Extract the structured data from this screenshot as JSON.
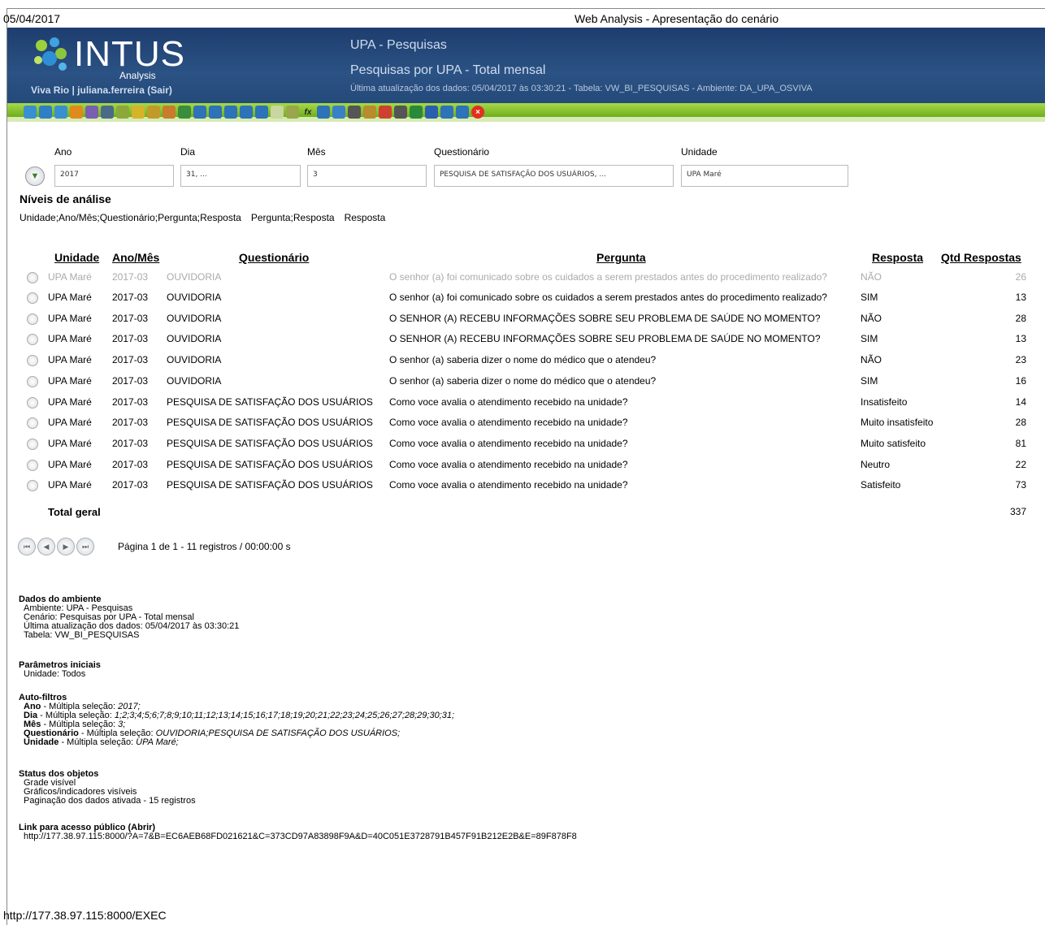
{
  "print_header": {
    "date": "05/04/2017",
    "title": "Web Analysis - Apresentação do cenário"
  },
  "print_footer": {
    "url": "http://177.38.97.115:8000/EXEC"
  },
  "banner": {
    "logo_word": "INTUS",
    "logo_sub": "Analysis",
    "user_text": "Viva Rio | juliana.ferreira (Sair)",
    "environment": "UPA - Pesquisas",
    "scenario": "Pesquisas por UPA - Total mensal",
    "update_line": "Última atualização dos dados: 05/04/2017 às 03:30:21 - Tabela: VW_BI_PESQUISAS - Ambiente: DA_UPA_OSVIVA"
  },
  "toolbar": {
    "icons": [
      "home-icon",
      "back-icon",
      "refresh-icon",
      "pin-icon",
      "presentation-icon",
      "screen-icon",
      "flask-icon",
      "filter-icon",
      "filter2-icon",
      "hierarchy-icon",
      "spellcheck-icon",
      "columns-icon",
      "grid-icon",
      "rows-icon",
      "sum-icon",
      "copy-icon",
      "table-icon",
      "bars-icon",
      "fx-icon",
      "chart-icon",
      "line-chart-icon",
      "pie-icon",
      "tree-icon",
      "traffic-light-icon",
      "print-icon",
      "excel-icon",
      "word-icon",
      "export-icon",
      "window-icon",
      "close-icon"
    ]
  },
  "filters": {
    "labels": {
      "ano": "Ano",
      "dia": "Dia",
      "mes": "Mês",
      "questionario": "Questionário",
      "unidade": "Unidade"
    },
    "values": {
      "ano": "2017",
      "dia": "31, ...",
      "mes": "3",
      "questionario": "PESQUISA DE SATISFAÇÃO DOS USUÁRIOS, ...",
      "unidade": "UPA Maré"
    }
  },
  "niveis": {
    "heading": "Níveis de análise",
    "items": [
      "Unidade;Ano/Mês;Questionário;Pergunta;Resposta",
      "Pergunta;Resposta",
      "Resposta"
    ]
  },
  "table": {
    "headers": {
      "unidade": "Unidade",
      "anomes": "Ano/Mês",
      "questionario": "Questionário",
      "pergunta": "Pergunta",
      "resposta": "Resposta",
      "qtd": "Qtd Respostas"
    },
    "rows": [
      {
        "unidade": "UPA Maré",
        "anomes": "2017-03",
        "questionario": "OUVIDORIA",
        "pergunta": "O senhor (a) foi comunicado sobre os cuidados a serem prestados antes do procedimento realizado?",
        "resposta": "NÃO",
        "qtd": "26"
      },
      {
        "unidade": "UPA Maré",
        "anomes": "2017-03",
        "questionario": "OUVIDORIA",
        "pergunta": "O senhor (a) foi comunicado sobre os cuidados a serem prestados antes do procedimento realizado?",
        "resposta": "SIM",
        "qtd": "13"
      },
      {
        "unidade": "UPA Maré",
        "anomes": "2017-03",
        "questionario": "OUVIDORIA",
        "pergunta": "O SENHOR (A) RECEBU INFORMAÇÕES SOBRE SEU PROBLEMA DE SAÚDE NO MOMENTO?",
        "resposta": "NÃO",
        "qtd": "28"
      },
      {
        "unidade": "UPA Maré",
        "anomes": "2017-03",
        "questionario": "OUVIDORIA",
        "pergunta": "O SENHOR (A) RECEBU INFORMAÇÕES SOBRE SEU PROBLEMA DE SAÚDE NO MOMENTO?",
        "resposta": "SIM",
        "qtd": "13"
      },
      {
        "unidade": "UPA Maré",
        "anomes": "2017-03",
        "questionario": "OUVIDORIA",
        "pergunta": "O senhor (a) saberia dizer o nome do médico que o atendeu?",
        "resposta": "NÃO",
        "qtd": "23"
      },
      {
        "unidade": "UPA Maré",
        "anomes": "2017-03",
        "questionario": "OUVIDORIA",
        "pergunta": "O senhor (a) saberia dizer o nome do médico que o atendeu?",
        "resposta": "SIM",
        "qtd": "16"
      },
      {
        "unidade": "UPA Maré",
        "anomes": "2017-03",
        "questionario": "PESQUISA DE SATISFAÇÃO DOS USUÁRIOS",
        "pergunta": "Como voce avalia o atendimento recebido na unidade?",
        "resposta": "Insatisfeito",
        "qtd": "14"
      },
      {
        "unidade": "UPA Maré",
        "anomes": "2017-03",
        "questionario": "PESQUISA DE SATISFAÇÃO DOS USUÁRIOS",
        "pergunta": "Como voce avalia o atendimento recebido na unidade?",
        "resposta": "Muito insatisfeito",
        "qtd": "28"
      },
      {
        "unidade": "UPA Maré",
        "anomes": "2017-03",
        "questionario": "PESQUISA DE SATISFAÇÃO DOS USUÁRIOS",
        "pergunta": "Como voce avalia o atendimento recebido na unidade?",
        "resposta": "Muito satisfeito",
        "qtd": "81"
      },
      {
        "unidade": "UPA Maré",
        "anomes": "2017-03",
        "questionario": "PESQUISA DE SATISFAÇÃO DOS USUÁRIOS",
        "pergunta": "Como voce avalia o atendimento recebido na unidade?",
        "resposta": "Neutro",
        "qtd": "22"
      },
      {
        "unidade": "UPA Maré",
        "anomes": "2017-03",
        "questionario": "PESQUISA DE SATISFAÇÃO DOS USUÁRIOS",
        "pergunta": "Como voce avalia o atendimento recebido na unidade?",
        "resposta": "Satisfeito",
        "qtd": "73"
      }
    ],
    "total_label": "Total geral",
    "total_value": "337"
  },
  "pager": {
    "text": "Página 1 de 1 - 11 registros / 00:00:00 s"
  },
  "info": {
    "dados_h": "Dados do ambiente",
    "dados": [
      "Ambiente: UPA - Pesquisas",
      "Cenário: Pesquisas por UPA - Total mensal",
      "Última atualização dos dados: 05/04/2017 às 03:30:21",
      "Tabela: VW_BI_PESQUISAS"
    ],
    "param_h": "Parâmetros iniciais",
    "param": [
      "Unidade: Todos"
    ],
    "auto_h": "Auto-filtros",
    "auto": [
      {
        "name": "Ano",
        "mode": " - Múltipla seleção: ",
        "val": "2017;"
      },
      {
        "name": "Dia",
        "mode": " - Múltipla seleção: ",
        "val": "1;2;3;4;5;6;7;8;9;10;11;12;13;14;15;16;17;18;19;20;21;22;23;24;25;26;27;28;29;30;31;"
      },
      {
        "name": "Mês",
        "mode": " - Múltipla seleção: ",
        "val": "3;"
      },
      {
        "name": "Questionário",
        "mode": " - Múltipla seleção: ",
        "val": "OUVIDORIA;PESQUISA DE SATISFAÇÃO DOS USUÁRIOS;"
      },
      {
        "name": "Unidade",
        "mode": " - Múltipla seleção: ",
        "val": "UPA Maré;"
      }
    ],
    "status_h": "Status dos objetos",
    "status": [
      "Grade visível",
      "Gráficos/indicadores visíveis",
      "Paginação dos dados ativada - 15 registros"
    ],
    "link_h": "Link para acesso público (Abrir)",
    "link": "http://177.38.97.115:8000/?A=7&B=EC6AEB68FD021621&C=373CD97A83898F9A&D=40C051E3728791B457F91B212E2B&E=89F878F8"
  }
}
